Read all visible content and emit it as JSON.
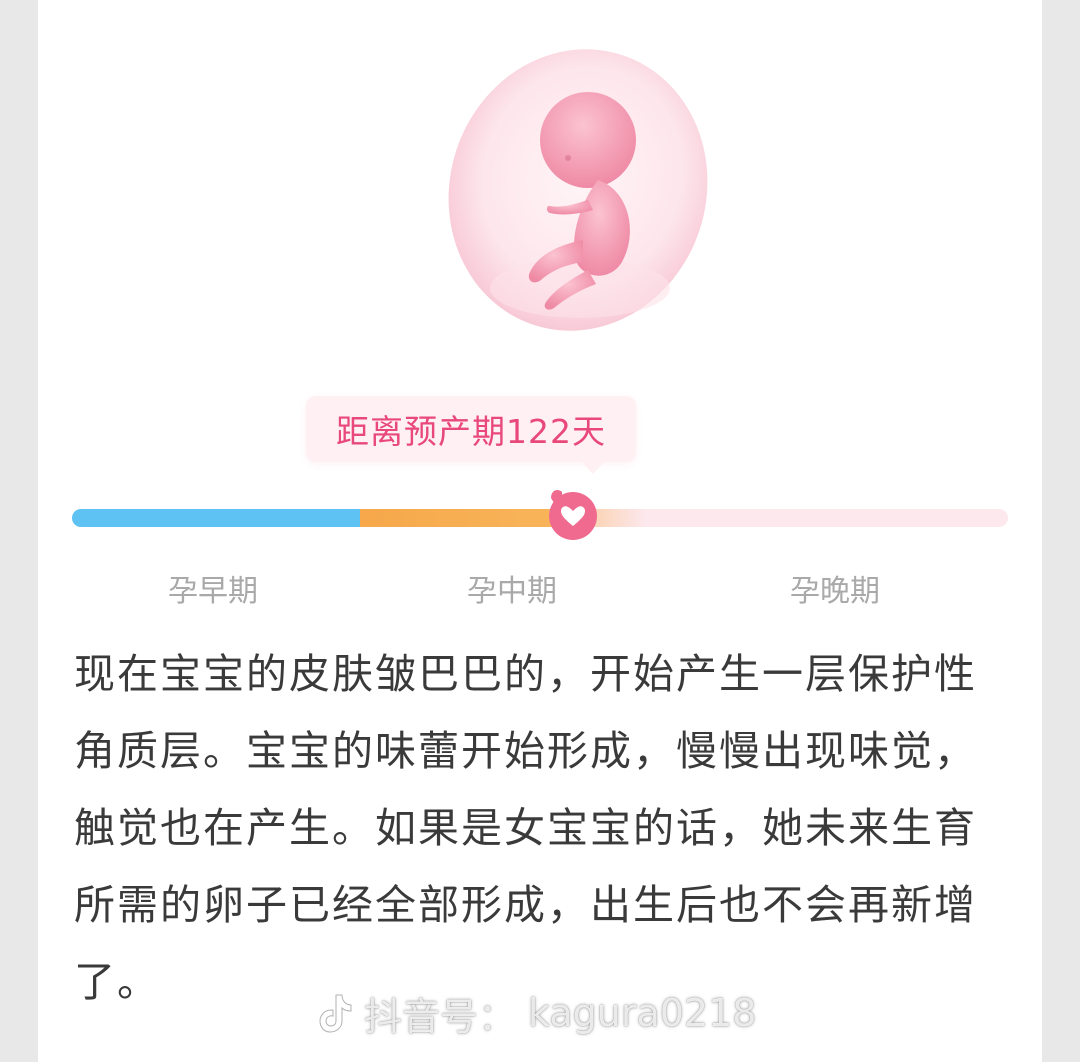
{
  "countdown": {
    "text": "距离预产期122天"
  },
  "progress": {
    "current_stage": "孕中期",
    "fraction": 0.53,
    "stages": [
      "孕早期",
      "孕中期",
      "孕晚期"
    ]
  },
  "description": "现在宝宝的皮肤皱巴巴的，开始产生一层保护性角质层。宝宝的味蕾开始形成，慢慢出现味觉，触觉也在产生。如果是女宝宝的话，她未来生育所需的卵子已经全部形成，出生后也不会再新增了。",
  "watermark": {
    "platform": "抖音号：",
    "account": "kagura0218",
    "icon": "douyin-logo-icon"
  },
  "colors": {
    "early": "#5ec2f2",
    "mid": "#f6a84a",
    "late": "#fde8ee",
    "accent": "#e8487a"
  }
}
